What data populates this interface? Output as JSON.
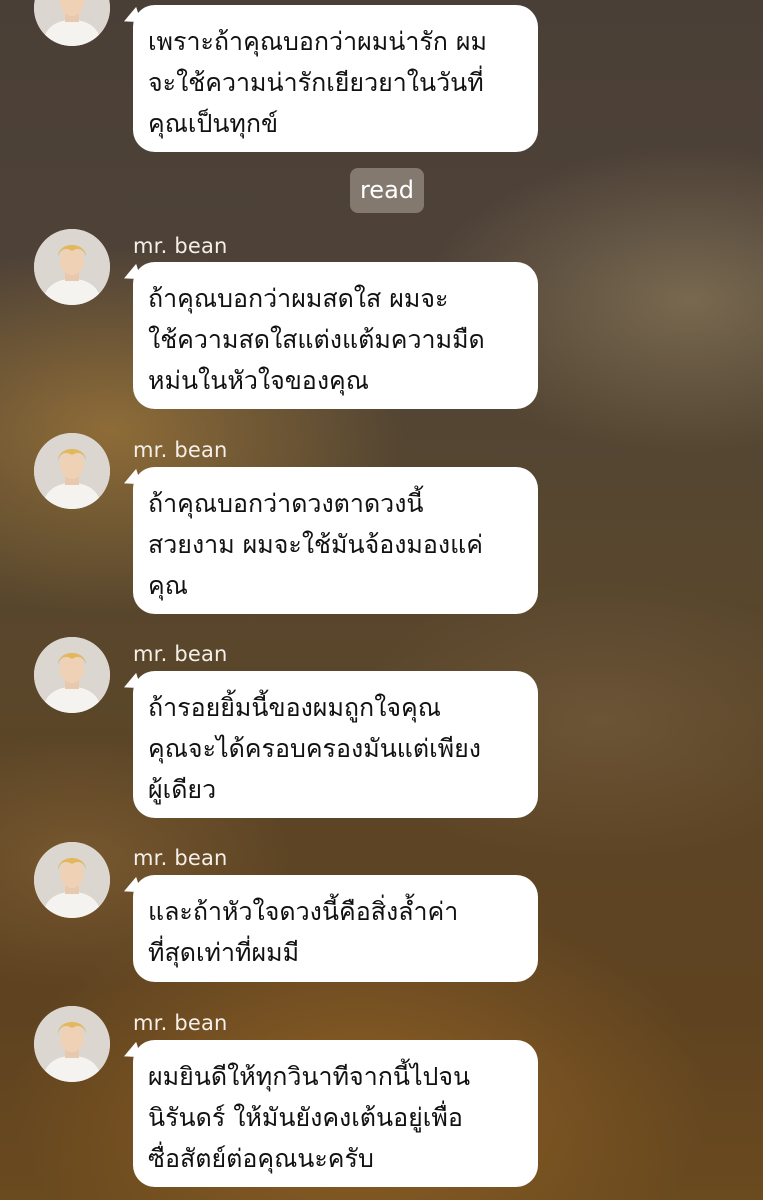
{
  "chat": {
    "read_label": "read",
    "messages": [
      {
        "sender": "",
        "lines": [
          "เพราะถ้าคุณบอกว่าผมน่ารัก ผม",
          "จะใช้ความน่ารักเยียวยาในวันที่",
          "คุณเป็นทุกข์"
        ]
      },
      {
        "sender": "mr. bean",
        "lines": [
          "ถ้าคุณบอกว่าผมสดใส ผมจะ",
          "ใช้ความสดใสแต่งแต้มความมืด",
          "หม่นในหัวใจของคุณ"
        ]
      },
      {
        "sender": "mr. bean",
        "lines": [
          "ถ้าคุณบอกว่าดวงตาดวงนี้",
          "สวยงาม ผมจะใช้มันจ้องมองแค่",
          "คุณ"
        ]
      },
      {
        "sender": "mr. bean",
        "lines": [
          "ถ้ารอยยิ้มนี้ของผมถูกใจคุณ",
          "คุณจะได้ครอบครองมันแต่เพียง",
          "ผู้เดียว"
        ]
      },
      {
        "sender": "mr. bean",
        "lines": [
          "และถ้าหัวใจดวงนี้คือสิ่งล้ำค่า",
          "ที่สุดเท่าที่ผมมี"
        ]
      },
      {
        "sender": "mr. bean",
        "lines": [
          "ผมยินดีให้ทุกวินาทีจากนี้ไปจน",
          "นิรันดร์ ให้มันยังคงเต้นอยู่เพื่อ",
          "ซื่อสัตย์ต่อคุณนะครับ"
        ]
      }
    ]
  },
  "icons": {
    "avatar": "avatar-icon"
  }
}
